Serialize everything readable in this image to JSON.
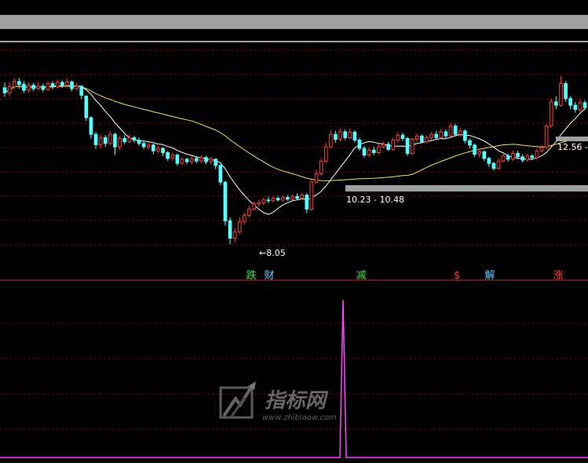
{
  "colors": {
    "background": "#000000",
    "up": "#ff3b3b",
    "down": "#54ffff",
    "ma_short": "#ffffff",
    "ma_long": "#e8e84e",
    "indicator": "#ff44ff",
    "grid": "#8a0000",
    "band": "#a0a0a0"
  },
  "chart_data": [
    {
      "type": "candlestick",
      "title": "",
      "grid": true,
      "series": [
        {
          "kind": "ohlc",
          "values": [
            [
              11.82,
              11.7,
              11.95,
              11.6
            ],
            [
              11.7,
              11.85,
              11.95,
              11.62
            ],
            [
              11.84,
              11.98,
              12.05,
              11.78
            ],
            [
              11.97,
              11.9,
              12.06,
              11.8
            ],
            [
              11.9,
              11.76,
              11.98,
              11.7
            ],
            [
              11.76,
              11.88,
              11.95,
              11.7
            ],
            [
              11.88,
              11.8,
              11.94,
              11.74
            ],
            [
              11.8,
              11.86,
              11.96,
              11.76
            ],
            [
              11.86,
              11.78,
              11.92,
              11.72
            ],
            [
              11.78,
              11.92,
              11.98,
              11.74
            ],
            [
              11.92,
              11.84,
              11.98,
              11.78
            ],
            [
              11.84,
              11.95,
              12.02,
              11.8
            ],
            [
              11.95,
              11.88,
              12.0,
              11.82
            ],
            [
              11.88,
              11.96,
              12.05,
              11.84
            ],
            [
              11.96,
              11.8,
              12.0,
              11.74
            ],
            [
              11.8,
              11.86,
              11.95,
              11.76
            ],
            [
              11.86,
              11.64,
              11.88,
              11.55
            ],
            [
              11.62,
              11.1,
              11.64,
              11.02
            ],
            [
              11.1,
              10.7,
              11.14,
              10.6
            ],
            [
              10.7,
              10.45,
              10.76,
              10.35
            ],
            [
              10.45,
              10.62,
              10.7,
              10.36
            ],
            [
              10.62,
              10.48,
              10.68,
              10.4
            ],
            [
              10.48,
              10.7,
              10.78,
              10.44
            ],
            [
              10.7,
              10.4,
              10.74,
              10.2
            ],
            [
              10.4,
              10.6,
              10.66,
              10.32
            ],
            [
              10.6,
              10.52,
              10.68,
              10.46
            ],
            [
              10.52,
              10.62,
              10.7,
              10.48
            ],
            [
              10.62,
              10.56,
              10.66,
              10.5
            ],
            [
              10.56,
              10.48,
              10.62,
              10.42
            ],
            [
              10.48,
              10.4,
              10.54,
              10.34
            ],
            [
              10.4,
              10.44,
              10.5,
              10.32
            ],
            [
              10.44,
              10.3,
              10.48,
              10.22
            ],
            [
              10.3,
              10.36,
              10.42,
              10.24
            ],
            [
              10.36,
              10.26,
              10.4,
              10.18
            ],
            [
              10.26,
              10.12,
              10.3,
              10.06
            ],
            [
              10.12,
              10.2,
              10.26,
              10.06
            ],
            [
              10.2,
              10.0,
              10.24,
              9.94
            ],
            [
              10.0,
              10.1,
              10.16,
              9.96
            ],
            [
              10.1,
              10.04,
              10.14,
              9.98
            ],
            [
              10.04,
              10.12,
              10.18,
              9.98
            ],
            [
              10.12,
              10.06,
              10.18,
              10.0
            ],
            [
              10.06,
              10.14,
              10.2,
              10.0
            ],
            [
              10.14,
              10.04,
              10.18,
              9.98
            ],
            [
              10.04,
              10.1,
              10.16,
              9.98
            ],
            [
              10.1,
              9.95,
              10.12,
              9.86
            ],
            [
              9.95,
              9.55,
              9.98,
              9.48
            ],
            [
              9.55,
              8.62,
              9.58,
              8.5
            ],
            [
              8.62,
              8.2,
              8.7,
              8.05
            ],
            [
              8.2,
              8.35,
              8.45,
              8.1
            ],
            [
              8.35,
              8.6,
              8.7,
              8.3
            ],
            [
              8.6,
              8.75,
              8.82,
              8.52
            ],
            [
              8.75,
              8.9,
              8.98,
              8.7
            ],
            [
              8.9,
              9.02,
              9.08,
              8.86
            ],
            [
              9.02,
              9.05,
              9.12,
              8.96
            ],
            [
              9.05,
              9.12,
              9.18,
              9.0
            ],
            [
              9.12,
              9.1,
              9.2,
              9.04
            ],
            [
              9.1,
              9.16,
              9.22,
              9.06
            ],
            [
              9.16,
              9.12,
              9.22,
              9.08
            ],
            [
              9.12,
              9.18,
              9.24,
              9.08
            ],
            [
              9.18,
              9.14,
              9.24,
              9.1
            ],
            [
              9.14,
              9.2,
              9.26,
              9.1
            ],
            [
              9.2,
              9.16,
              9.28,
              9.12
            ],
            [
              9.16,
              9.24,
              9.3,
              9.12
            ],
            [
              9.24,
              8.9,
              9.28,
              8.8
            ],
            [
              8.9,
              9.55,
              9.6,
              8.86
            ],
            [
              9.55,
              9.75,
              9.85,
              9.5
            ],
            [
              9.75,
              10.05,
              10.12,
              9.7
            ],
            [
              10.05,
              10.4,
              10.5,
              10.0
            ],
            [
              10.4,
              10.7,
              10.8,
              10.36
            ],
            [
              10.7,
              10.58,
              10.78,
              10.5
            ],
            [
              10.58,
              10.76,
              10.84,
              10.52
            ],
            [
              10.76,
              10.62,
              10.82,
              10.56
            ],
            [
              10.62,
              10.75,
              10.85,
              10.58
            ],
            [
              10.75,
              10.56,
              10.8,
              10.5
            ],
            [
              10.56,
              10.36,
              10.62,
              10.3
            ],
            [
              10.36,
              10.2,
              10.42,
              10.14
            ],
            [
              10.2,
              10.32,
              10.38,
              10.14
            ],
            [
              10.32,
              10.26,
              10.4,
              10.2
            ],
            [
              10.26,
              10.4,
              10.46,
              10.22
            ],
            [
              10.4,
              10.46,
              10.52,
              10.36
            ],
            [
              10.46,
              10.34,
              10.52,
              10.3
            ],
            [
              10.34,
              10.56,
              10.62,
              10.3
            ],
            [
              10.56,
              10.68,
              10.75,
              10.5
            ],
            [
              10.68,
              10.6,
              10.74,
              10.54
            ],
            [
              10.6,
              10.24,
              10.64,
              10.18
            ],
            [
              10.24,
              10.58,
              10.62,
              10.2
            ],
            [
              10.58,
              10.66,
              10.72,
              10.52
            ],
            [
              10.66,
              10.52,
              10.7,
              10.48
            ],
            [
              10.52,
              10.62,
              10.68,
              10.48
            ],
            [
              10.62,
              10.7,
              10.76,
              10.56
            ],
            [
              10.7,
              10.62,
              10.78,
              10.58
            ],
            [
              10.62,
              10.76,
              10.84,
              10.58
            ],
            [
              10.76,
              10.66,
              10.82,
              10.6
            ],
            [
              10.66,
              10.9,
              10.98,
              10.62
            ],
            [
              10.9,
              10.7,
              10.96,
              10.64
            ],
            [
              10.7,
              10.78,
              10.84,
              10.64
            ],
            [
              10.78,
              10.55,
              10.82,
              10.48
            ],
            [
              10.55,
              10.44,
              10.6,
              10.36
            ],
            [
              10.44,
              10.22,
              10.48,
              10.16
            ],
            [
              10.22,
              10.28,
              10.34,
              10.14
            ],
            [
              10.28,
              10.12,
              10.32,
              10.06
            ],
            [
              10.12,
              10.0,
              10.16,
              9.92
            ],
            [
              10.0,
              9.88,
              10.04,
              9.82
            ],
            [
              9.88,
              10.06,
              10.12,
              9.84
            ],
            [
              10.06,
              10.18,
              10.24,
              10.02
            ],
            [
              10.18,
              10.1,
              10.24,
              10.04
            ],
            [
              10.1,
              10.24,
              10.3,
              10.06
            ],
            [
              10.24,
              10.16,
              10.3,
              10.1
            ],
            [
              10.16,
              10.08,
              10.22,
              10.02
            ],
            [
              10.08,
              10.18,
              10.24,
              10.04
            ],
            [
              10.18,
              10.14,
              10.22,
              10.08
            ],
            [
              10.14,
              10.3,
              10.36,
              10.1
            ],
            [
              10.3,
              10.38,
              10.44,
              10.26
            ],
            [
              10.38,
              10.9,
              10.96,
              10.34
            ],
            [
              10.9,
              11.48,
              11.56,
              10.86
            ],
            [
              11.48,
              11.4,
              11.62,
              11.3
            ],
            [
              11.4,
              11.92,
              12.1,
              11.36
            ],
            [
              11.92,
              11.56,
              11.98,
              11.48
            ],
            [
              11.56,
              11.4,
              11.62,
              11.3
            ],
            [
              11.4,
              11.3,
              11.48,
              11.22
            ],
            [
              11.3,
              11.46,
              11.54,
              11.24
            ],
            [
              11.46,
              11.34,
              11.52,
              11.28
            ]
          ]
        },
        {
          "name": "",
          "kind": "ma",
          "color": "#ffffff",
          "period": 10
        },
        {
          "name": "",
          "kind": "ma",
          "color": "#e8e84e",
          "period": 40
        }
      ],
      "ylim": [
        7.7,
        12.8
      ],
      "annotations": [
        {
          "text": "8.05",
          "arrow": "←"
        },
        {
          "text": "10.23 - 10.48"
        },
        {
          "text": "12.56 -"
        }
      ],
      "signal_labels": [
        {
          "text": "跌",
          "color": "#37e637"
        },
        {
          "text": "财",
          "color": "#5fd0ff"
        },
        {
          "text": "减",
          "color": "#37e637"
        },
        {
          "text": "$",
          "color": "#ff3b3b"
        },
        {
          "text": "解",
          "color": "#5fd0ff"
        },
        {
          "text": "涨",
          "color": "#ff3b3b"
        }
      ]
    },
    {
      "type": "line",
      "title": "",
      "grid": true,
      "series": [
        {
          "name": "",
          "color": "#ff44ff",
          "spike_index": 64,
          "spike_value": 1.0,
          "baseline": 0
        }
      ],
      "ylim": [
        0,
        1.05
      ]
    }
  ],
  "watermark": {
    "brand": "指标网",
    "url": "www.zhibiaow.com"
  }
}
